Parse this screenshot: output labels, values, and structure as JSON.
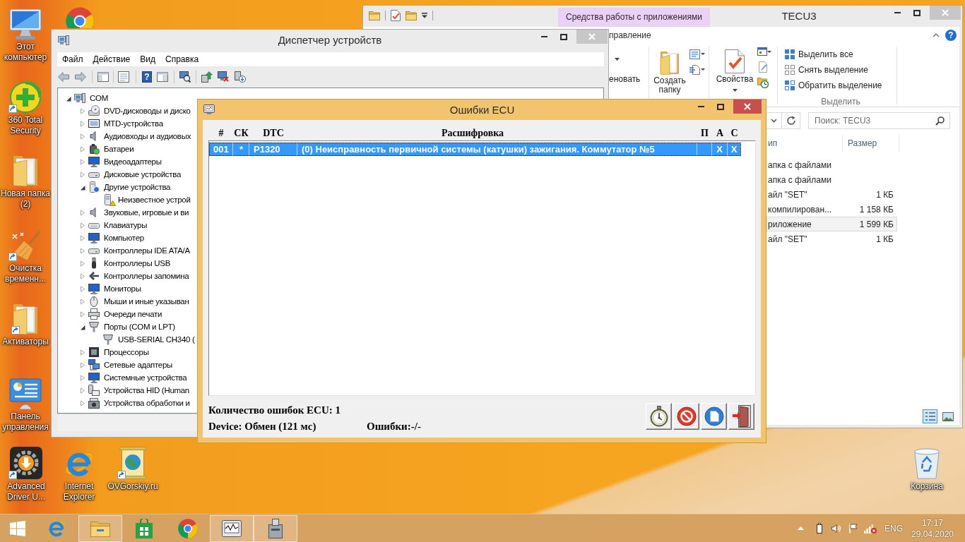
{
  "desktop": {
    "icons": [
      {
        "label": "Этот компьютер",
        "shortcut": false
      },
      {
        "label": "360 Total Security",
        "shortcut": true
      },
      {
        "label": "Новая папка (2)",
        "shortcut": false
      },
      {
        "label": "Очистка временн...",
        "shortcut": true
      },
      {
        "label": "Активаторы",
        "shortcut": true
      },
      {
        "label": "Панель управления",
        "shortcut": false
      },
      {
        "label": "Advanced Driver U...",
        "shortcut": true
      },
      {
        "label": "Internet Explorer",
        "shortcut": false
      },
      {
        "label": "OVGorskiy.ru",
        "shortcut": true
      },
      {
        "label": "Корзина",
        "shortcut": false
      }
    ]
  },
  "explorer": {
    "active": false,
    "title": "TECU3",
    "context_tab": "Средства работы с приложениями",
    "ribbon_tab": "правление",
    "help_button": "?",
    "ribbon": {
      "rename": "еновать",
      "new_folder": "Создать папку",
      "properties": "Свойства",
      "select_all": "Выделить все",
      "select_none": "Снять выделение",
      "invert_selection": "Обратить выделение",
      "group_label": "Выделить"
    },
    "search": {
      "placeholder": "Поиск: TECU3"
    },
    "columns": [
      "ип",
      "Размер"
    ],
    "rows": [
      {
        "type": "апка с файлами",
        "selected": false
      },
      {
        "type": "апка с файлами",
        "selected": false
      },
      {
        "type": "айл \"SET\"",
        "size": "1 КБ",
        "selected": false
      },
      {
        "type": "компилирован...",
        "size": "1 158 КБ",
        "selected": false
      },
      {
        "type": "риложение",
        "size": "1 599 КБ",
        "selected": true
      },
      {
        "type": "айл \"SET\"",
        "size": "1 КБ",
        "selected": false
      }
    ],
    "view_modes": [
      {
        "selected": true
      },
      {
        "selected": false
      }
    ]
  },
  "device_manager": {
    "active": false,
    "title": "Диспетчер устройств",
    "menu": [
      "Файл",
      "Действие",
      "Вид",
      "Справка"
    ],
    "help_button": "?",
    "tree": {
      "label": "COM",
      "expanded": true,
      "children": [
        {
          "label": "DVD-дисководы и диско",
          "expanded": false
        },
        {
          "label": "MTD-устройства",
          "expanded": false
        },
        {
          "label": "Аудиовходы и аудиовых",
          "expanded": false
        },
        {
          "label": "Батареи",
          "expanded": false
        },
        {
          "label": "Видеоадаптеры",
          "expanded": false
        },
        {
          "label": "Дисковые устройства",
          "expanded": false
        },
        {
          "label": "Другие устройства",
          "expanded": true,
          "children": [
            {
              "label": "Неизвестное устрой",
              "warning": true
            }
          ]
        },
        {
          "label": "Звуковые, игровые и ви",
          "expanded": false
        },
        {
          "label": "Клавиатуры",
          "expanded": false
        },
        {
          "label": "Компьютер",
          "expanded": false
        },
        {
          "label": "Контроллеры IDE ATA/A",
          "expanded": false
        },
        {
          "label": "Контроллеры USB",
          "expanded": false
        },
        {
          "label": "Контроллеры запомина",
          "expanded": false
        },
        {
          "label": "Мониторы",
          "expanded": false
        },
        {
          "label": "Мыши и иные указыван",
          "expanded": false
        },
        {
          "label": "Очереди печати",
          "expanded": false
        },
        {
          "label": "Порты (COM и LPT)",
          "expanded": true,
          "children": [
            {
              "label": "USB-SERIAL CH340 (",
              "warning": false
            }
          ]
        },
        {
          "label": "Процессоры",
          "expanded": false
        },
        {
          "label": "Сетевые адаптеры",
          "expanded": false
        },
        {
          "label": "Системные устройства",
          "expanded": false
        },
        {
          "label": "Устройства HID (Human",
          "expanded": false
        },
        {
          "label": "Устройства обработки и",
          "expanded": false
        }
      ]
    }
  },
  "ecu": {
    "active": true,
    "title": "Ошибки ECU",
    "columns": [
      "#",
      "СК",
      "DTC",
      "Расшифровка",
      "П",
      "А",
      "С"
    ],
    "rows": [
      {
        "number": "001",
        "ck": "*",
        "dtc": "P1320",
        "description": "(0) Неисправность первичной системы (катушки) зажигания. Коммутатор №5",
        "a": "X",
        "c": "X",
        "selected": true
      }
    ],
    "error_count": "Количество ошибок ECU: 1",
    "device_status": "Device: Обмен (121 мс)",
    "errors": "Ошибки:-/-"
  },
  "taskbar": {
    "apps": [
      {
        "running": false
      },
      {
        "running": true
      },
      {
        "running": false
      },
      {
        "running": false
      },
      {
        "running": true
      },
      {
        "running": true
      }
    ],
    "language": "ENG",
    "time": "17:17",
    "date": "29.04.2020"
  }
}
